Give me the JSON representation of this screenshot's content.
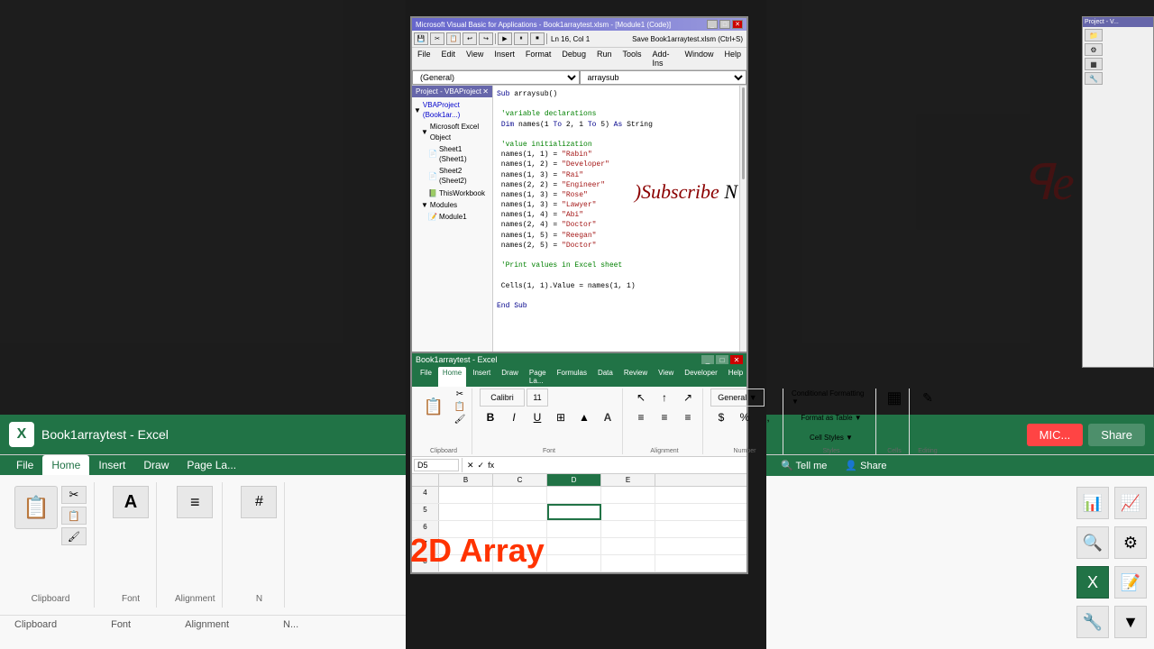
{
  "app": {
    "title": "Microsoft Visual Basic for Applications - Book1arraytest.xlsm - [Module1 (Code)]",
    "excel_title": "Book1arraytest - Excel",
    "vba_project_title": "Project - VBAProject"
  },
  "vba_window": {
    "title": "Microsoft Visual Basic for Applications - Book1arraytest.xlsm - [Module1 (Code)]",
    "menubar": [
      "File",
      "Edit",
      "View",
      "Insert",
      "Format",
      "Debug",
      "Run",
      "Tools",
      "Add-Ins",
      "Window",
      "Help"
    ],
    "combo_general": "(General)",
    "combo_arraysub": "arraysub",
    "project_title": "Project - VBAProject",
    "tree": [
      "VBAProject (Book1ar...",
      "Microsoft Excel Object",
      "Sheet1 (Sheet1)",
      "Sheet2 (Sheet2)",
      "ThisWorkbook",
      "Modules",
      "Module1"
    ],
    "code": "Sub arraysub()\n\n 'variable declarations\n Dim names(1 To 2, 1 To 5) As String\n\n 'value initialization\n names(1, 1) = \"Rabin\"\n names(1, 2) = \"Developer\"\n names(1, 3) = \"Rai\"\n names(2, 2) = \"Engineer\"\n names(1, 3) = \"Rose\"\n names(1, 3) = \"Lawyer\"\n names(1, 4) = \"Abi\"\n names(2, 4) = \"Doctor\"\n names(1, 5) = \"Reegan\"\n names(2, 5) = \"Doctor\"\n\n 'Print values in Excel sheet\n\n Cells(1, 1).Value = names(1, 1)\n\nEnd Sub"
  },
  "excel_window": {
    "title": "Book1arraytest - Excel",
    "tabs": [
      "File",
      "Home",
      "Insert",
      "Draw",
      "Page Layout",
      "Formulas",
      "Data",
      "Review",
      "View",
      "Developer",
      "Help",
      "Tell me",
      "Share"
    ],
    "ribbon_groups": [
      "Paste",
      "Font",
      "Alignment",
      "Number",
      "Conditional Formatting",
      "Format as Table",
      "Cell Styles",
      "Cells",
      "Editing"
    ],
    "name_box": "D5",
    "formula_bar": "",
    "col_headers": [
      "B",
      "C",
      "D",
      "E"
    ],
    "rows": [
      4,
      5,
      6,
      7,
      8
    ]
  },
  "overlay": {
    "subscribe_text": "Subscribe",
    "subscribe_n": "N",
    "array_2d_text": "2D Array"
  },
  "left_bar": {
    "excel_icon": "X",
    "filename": "Book1arraytest - Excel"
  },
  "left_ribbon": {
    "tabs": [
      "File",
      "Home",
      "Insert",
      "Draw",
      "Page La..."
    ],
    "active_tab": "Home",
    "groups": [
      {
        "name": "Clipboard",
        "icon": "📋"
      },
      {
        "name": "Font",
        "icon": "A"
      },
      {
        "name": "Alignment",
        "icon": "≡"
      },
      {
        "name": "N",
        "icon": "#"
      }
    ]
  },
  "right_bar": {
    "share_label": "Share",
    "button_label": "MIC..."
  },
  "right_ribbon": {
    "groups": [
      {
        "icon": "📊"
      },
      {
        "icon": "🔍"
      },
      {
        "icon": "📁"
      },
      {
        "icon": "🔧"
      }
    ]
  },
  "icons": {
    "cut": "✂",
    "copy": "📋",
    "paste": "📋",
    "font_a": "A",
    "bold": "B",
    "italic": "I",
    "underline": "U",
    "align_left": "≡",
    "align_center": "≡",
    "percent": "%",
    "comma": ",",
    "cells": "▦",
    "search": "🔍",
    "share": "👤",
    "minimize": "_",
    "maximize": "□",
    "close": "✕",
    "excel_logo": "X"
  }
}
